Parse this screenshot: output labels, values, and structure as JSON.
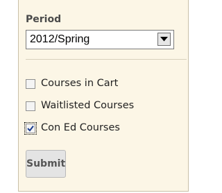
{
  "filter": {
    "period_label": "Period",
    "period_selected": "2012/Spring",
    "checkboxes": [
      {
        "label": "Courses in Cart",
        "checked": false
      },
      {
        "label": "Waitlisted Courses",
        "checked": false
      },
      {
        "label": "Con Ed Courses",
        "checked": true
      }
    ],
    "submit_label": "Submit"
  },
  "colors": {
    "panel_background": "#fcf6e6",
    "panel_border": "#c9c0a8",
    "label_text": "#4a4a4a"
  },
  "icons": {
    "select_arrow": "chevron-down-icon",
    "checkmark": "checkmark-icon"
  }
}
